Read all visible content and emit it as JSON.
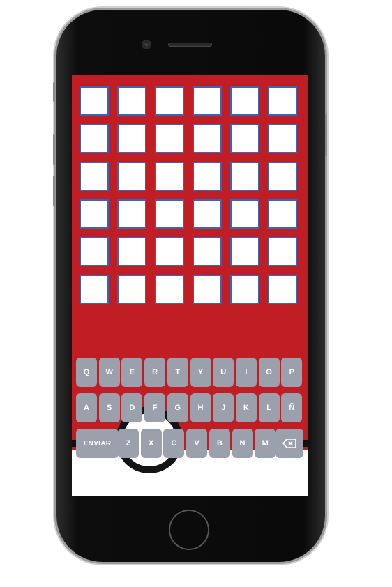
{
  "keyboard": {
    "row1": [
      "Q",
      "W",
      "E",
      "R",
      "T",
      "Y",
      "U",
      "I",
      "O",
      "P"
    ],
    "row2": [
      "A",
      "S",
      "D",
      "F",
      "G",
      "H",
      "J",
      "K",
      "L",
      "Ñ"
    ],
    "row3": [
      "Z",
      "X",
      "C",
      "V",
      "B",
      "N",
      "M"
    ],
    "send_label": "ENVIAR",
    "delete_icon": "backspace-icon"
  },
  "grid": {
    "rows": 6,
    "cols": 6
  },
  "colors": {
    "background": "#c01e24",
    "cell_border": "#3b64b8",
    "key": "#9aa0ac"
  }
}
